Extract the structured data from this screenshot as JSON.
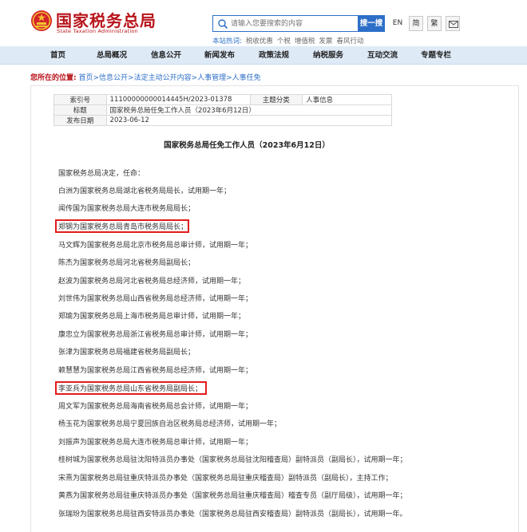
{
  "site": {
    "name_cn": "国家税务总局",
    "name_en": "State Taxation Administration"
  },
  "search": {
    "placeholder": "请输入您要搜索的内容",
    "button": "搜一搜"
  },
  "tools": {
    "en": "EN",
    "simplified": "简",
    "traditional": "繁"
  },
  "hot": {
    "title": "本站热词:",
    "terms": [
      "税收优惠",
      "个税",
      "增值税",
      "发票",
      "春风行动"
    ]
  },
  "nav": {
    "items": [
      "首页",
      "总局概况",
      "信息公开",
      "新闻发布",
      "政策法规",
      "纳税服务",
      "互动交流",
      "专题专栏"
    ]
  },
  "breadcrumb": {
    "label": "您所在的位置:",
    "path": "首页>信息公开>法定主动公开内容>人事管理>人事任免"
  },
  "meta": {
    "index_label": "索引号",
    "index_value": "11100000000014445H/2023-01378",
    "category_label": "主题分类",
    "category_value": "人事信息",
    "title_label": "标题",
    "title_value": "国家税务总局任免工作人员（2023年6月12日）",
    "date_label": "发布日期",
    "date_value": "2023-06-12"
  },
  "document": {
    "title": "国家税务总局任免工作人员（2023年6月12日）",
    "lines": [
      "国家税务总局决定，任命：",
      "白洲为国家税务总局湖北省税务局局长，试用期一年；",
      "闻传国为国家税务总局大连市税务局局长；",
      "郑钢为国家税务总局青岛市税务局局长；",
      "马文辉为国家税务总局北京市税务局总审计师，试用期一年；",
      "陈杰为国家税务总局河北省税务局副局长；",
      "赵波为国家税务总局河北省税务局总经济师，试用期一年；",
      "刘世伟为国家税务总局山西省税务局总经济师，试用期一年；",
      "郑瑜为国家税务总局上海市税务局总审计师，试用期一年；",
      "康忠立为国家税务总局浙江省税务局总审计师，试用期一年；",
      "张津为国家税务总局福建省税务局副局长；",
      "赖慧慧为国家税务总局江西省税务局总经济师，试用期一年；",
      "李亚兵为国家税务总局山东省税务局副局长；",
      "周文军为国家税务总局海南省税务局总会计师，试用期一年；",
      "杨玉花为国家税务总局宁夏回族自治区税务局总经济师，试用期一年；",
      "刘振声为国家税务总局大连市税务局总审计师，试用期一年；",
      "桂树城为国家税务总局驻沈阳特派员办事处（国家税务总局驻沈阳稽查局）副特派员（副局长），试用期一年；",
      "宋熹为国家税务总局驻重庆特派员办事处（国家税务总局驻重庆稽查局）副特派员（副局长），主持工作；",
      "黄燕为国家税务总局驻重庆特派员办事处（国家税务总局驻重庆稽查局）稽查专员（副厅局级），试用期一年；",
      "张瑞玢为国家税务总局驻西安特派员办事处（国家税务总局驻西安稽查局）副特派员（副局长），试用期一年。"
    ]
  },
  "colors": {
    "brand_red": "#b8141b",
    "link_blue": "#2d6fc8",
    "nav_bg": "#dfeaf7",
    "highlight_box": "#e11d1d"
  }
}
